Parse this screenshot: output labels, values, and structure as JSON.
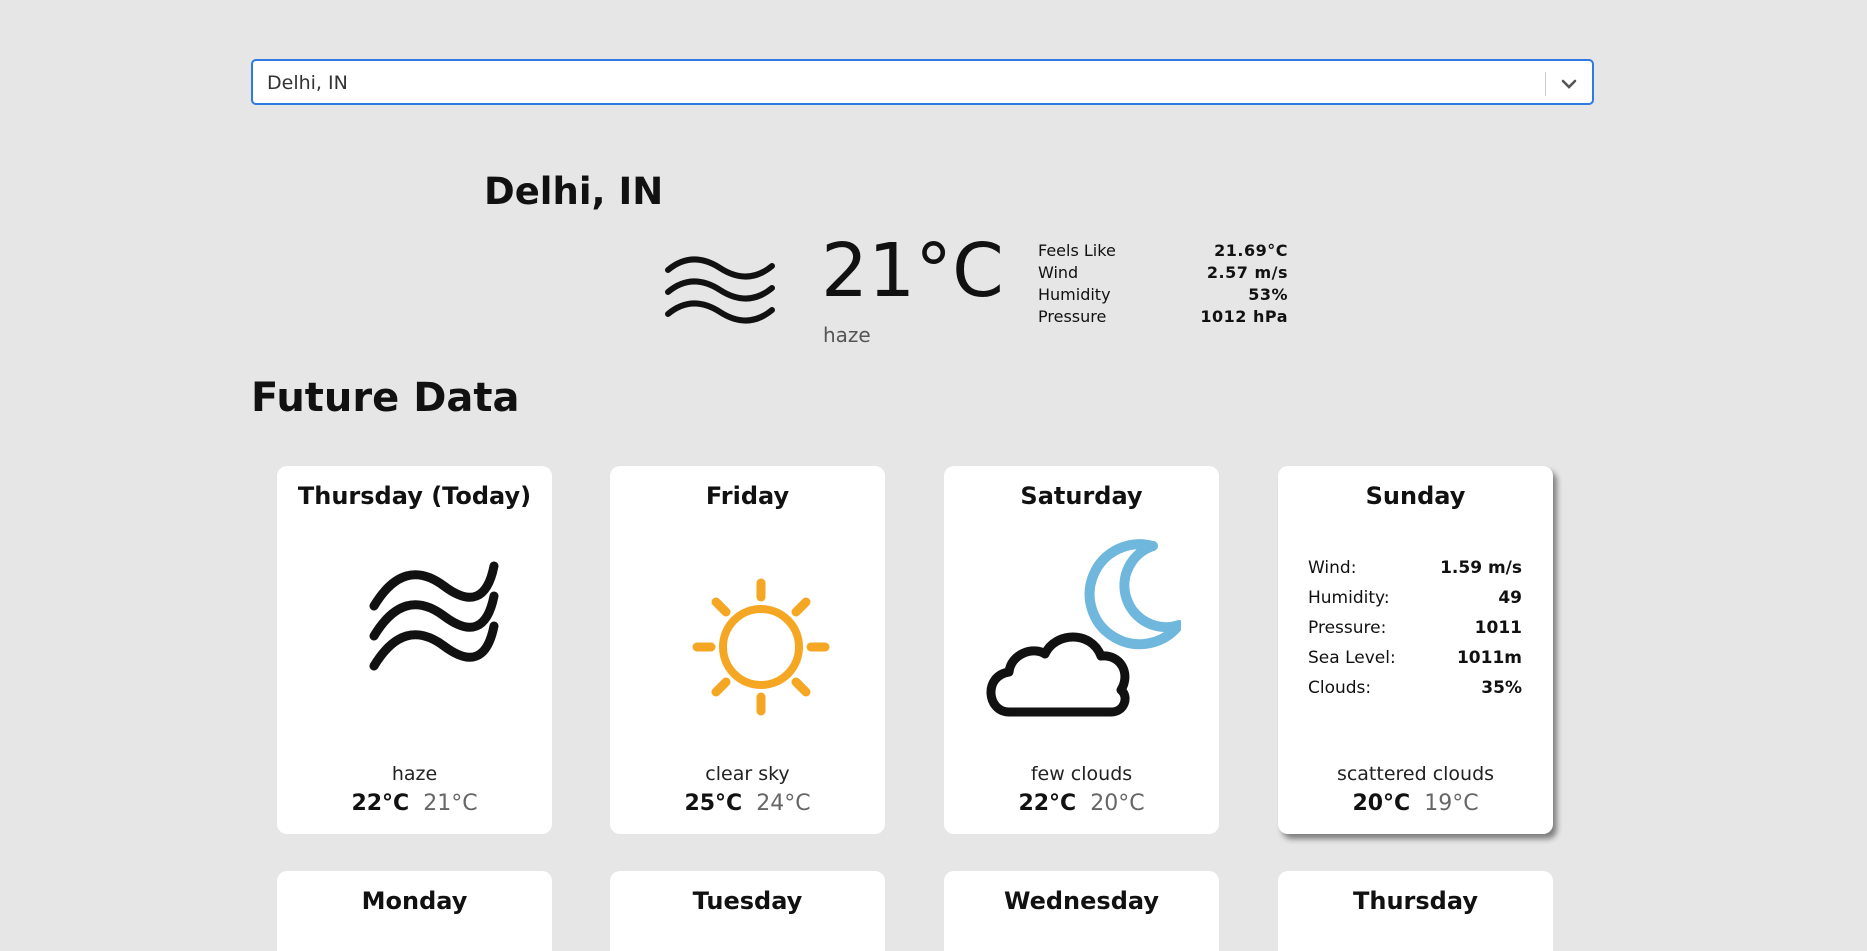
{
  "search": {
    "value": "Delhi, IN"
  },
  "current": {
    "city": "Delhi, IN",
    "temp": "21°C",
    "description": "haze",
    "icon": "haze-icon",
    "details": [
      {
        "label": "Feels Like",
        "value": "21.69°C"
      },
      {
        "label": "Wind",
        "value": "2.57 m/s"
      },
      {
        "label": "Humidity",
        "value": "53%"
      },
      {
        "label": "Pressure",
        "value": "1012 hPa"
      }
    ]
  },
  "future": {
    "title": "Future Data",
    "days": [
      {
        "day": "Thursday (Today)",
        "icon": "haze-icon",
        "description": "haze",
        "max": "22°C",
        "min": "21°C"
      },
      {
        "day": "Friday",
        "icon": "sun-icon",
        "description": "clear sky",
        "max": "25°C",
        "min": "24°C"
      },
      {
        "day": "Saturday",
        "icon": "cloud-moon-icon",
        "description": "few clouds",
        "max": "22°C",
        "min": "20°C"
      },
      {
        "day": "Sunday",
        "description": "scattered clouds",
        "max": "20°C",
        "min": "19°C",
        "details": [
          {
            "label": "Wind:",
            "value": "1.59 m/s"
          },
          {
            "label": "Humidity:",
            "value": "49"
          },
          {
            "label": "Pressure:",
            "value": "1011"
          },
          {
            "label": "Sea Level:",
            "value": "1011m"
          },
          {
            "label": "Clouds:",
            "value": "35%"
          }
        ]
      }
    ],
    "next_days": [
      "Monday",
      "Tuesday",
      "Wednesday",
      "Thursday"
    ]
  },
  "colors": {
    "accent": "#2e7ae0",
    "sun": "#f5a623",
    "moon": "#6fb7dc",
    "background": "#e6e6e6"
  }
}
